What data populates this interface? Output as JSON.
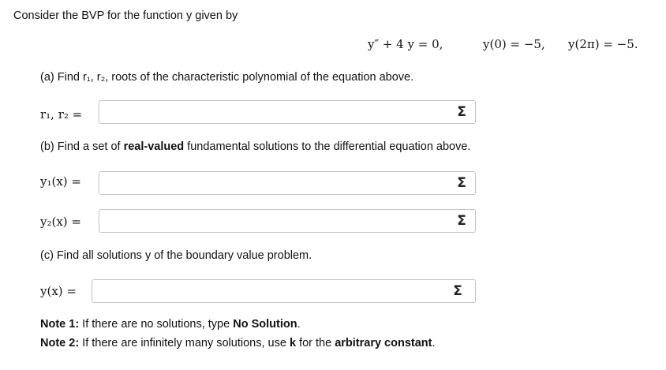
{
  "intro": "Consider the BVP for the function y given by",
  "equation": {
    "ode": "y″ + 4 y = 0,",
    "bc1": "y(0) = −5,",
    "bc2": "y(2π) = −5."
  },
  "part_a": {
    "prompt": "(a) Find r₁, r₂, roots of the characteristic polynomial of the equation above.",
    "label": "r₁, r₂ =",
    "value": ""
  },
  "part_b": {
    "prompt_before": "(b) Find a set of ",
    "prompt_bold": "real-valued",
    "prompt_after": " fundamental solutions to the differential equation above.",
    "y1_label": "y₁(x) =",
    "y1_value": "",
    "y2_label": "y₂(x) =",
    "y2_value": ""
  },
  "part_c": {
    "prompt": "(c) Find all solutions y of the boundary value problem.",
    "label": "y(x) =",
    "value": ""
  },
  "sigma_symbol": "Σ",
  "notes": {
    "note1_label": "Note 1:",
    "note1_text_before": " If there are no solutions, type ",
    "note1_bold": "No Solution",
    "note1_text_after": ".",
    "note2_label": "Note 2:",
    "note2_text_before": " If there are infinitely many solutions, use ",
    "note2_bold1": "k",
    "note2_text_middle": " for the ",
    "note2_bold2": "arbitrary constant",
    "note2_text_after": "."
  }
}
